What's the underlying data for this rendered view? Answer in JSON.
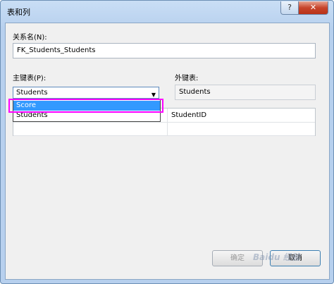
{
  "window": {
    "title": "表和列",
    "help_symbol": "?",
    "close_symbol": "✕"
  },
  "relationship": {
    "label": "关系名(N):",
    "value": "FK_Students_Students"
  },
  "primary_key": {
    "label": "主键表(P):",
    "selected": "Students",
    "options": [
      "Score",
      "Students"
    ],
    "highlighted_option": "Score"
  },
  "foreign_key": {
    "label": "外键表:",
    "value": "Students"
  },
  "columns_grid": {
    "rows": [
      {
        "pk_column": "",
        "fk_column": "StudentID"
      },
      {
        "pk_column": "",
        "fk_column": ""
      }
    ]
  },
  "buttons": {
    "ok": "确定",
    "cancel": "取消"
  },
  "watermark": "Baidu 经验",
  "colors": {
    "selection": "#3399ff",
    "annotation": "#ff00ff",
    "close_button": "#c7442b"
  },
  "icons": {
    "combo_arrow": "▼"
  }
}
